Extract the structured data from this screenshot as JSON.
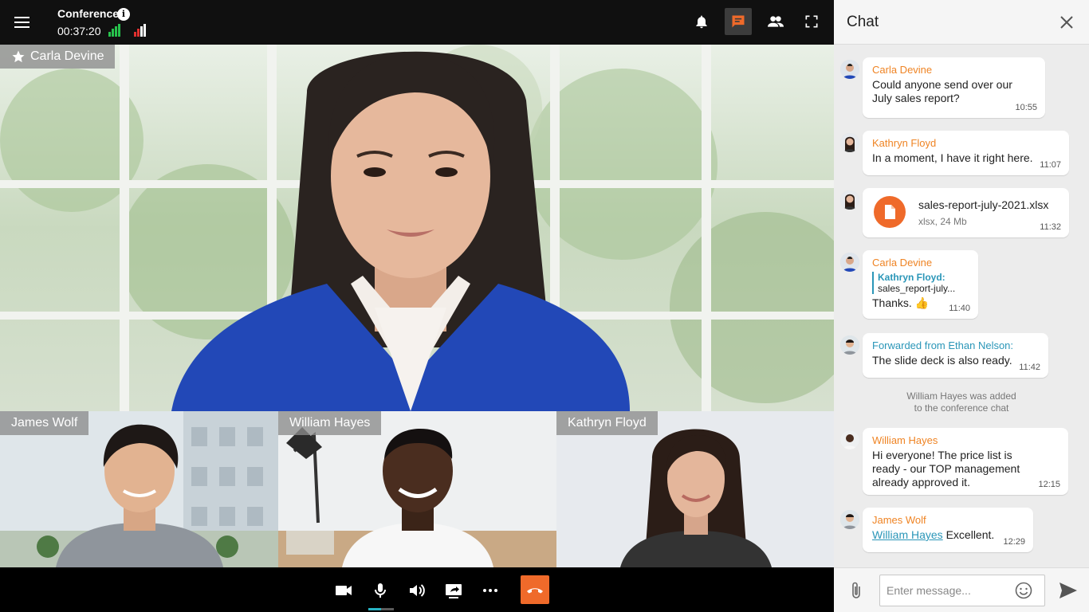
{
  "conference": {
    "title": "Conference",
    "timer": "00:37:20",
    "main_speaker": "Carla Devine",
    "tiles": [
      {
        "name": "James Wolf"
      },
      {
        "name": "William Hayes"
      },
      {
        "name": "Kathryn Floyd"
      }
    ],
    "mic_level": 0.5
  },
  "chat": {
    "title": "Chat",
    "messages": [
      {
        "sender": "Carla Devine",
        "text_line1": "Could anyone send over our",
        "text_line2": "July sales report?",
        "time": "10:55"
      },
      {
        "sender": "Kathryn Floyd",
        "text": "In a moment, I have it right here.",
        "time": "11:07"
      },
      {
        "file_name": "sales-report-july-2021.xlsx",
        "file_meta": "xlsx, 24 Mb",
        "time": "11:32"
      },
      {
        "sender": "Carla Devine",
        "quote_name": "Kathryn Floyd:",
        "quote_text": "sales_report-july...",
        "text": "Thanks.",
        "emoji": "👍",
        "time": "11:40"
      },
      {
        "forwarded": "Forwarded from Ethan Nelson:",
        "text": "The slide deck is also ready.",
        "time": "11:42"
      },
      {
        "sender": "William Hayes",
        "text_line1": "Hi everyone! The price list is",
        "text_line2": "ready - our TOP management",
        "text_line3": "already approved it.",
        "time": "12:15"
      },
      {
        "sender": "James Wolf",
        "mention": "William Hayes",
        "text": "Excellent.",
        "time": "12:29"
      }
    ],
    "system_note_line1": "William Hayes was added",
    "system_note_line2": "to the conference chat",
    "input_placeholder": "Enter message..."
  },
  "colors": {
    "accent": "#ef6a2a",
    "sender_name": "#ef8424",
    "link": "#2a96b8",
    "signal_good": "#27c24c",
    "signal_bad": "#e0302f"
  }
}
